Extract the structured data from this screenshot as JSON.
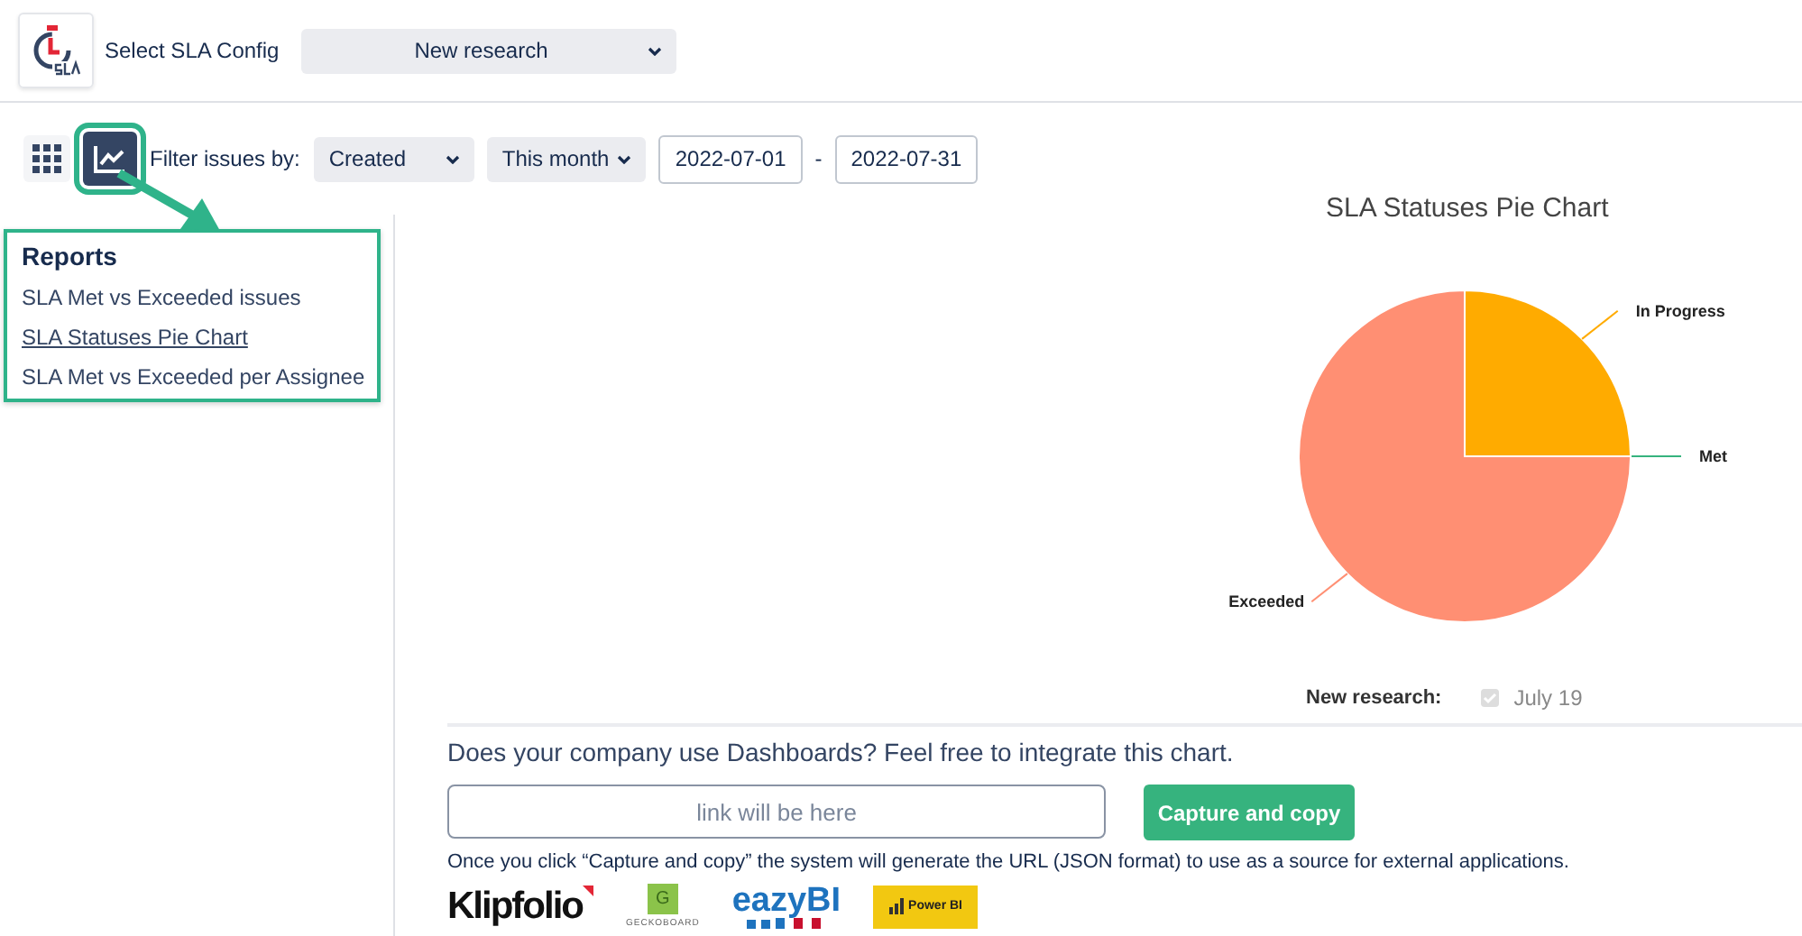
{
  "header": {
    "label": "Select SLA Config",
    "config": "New research"
  },
  "filter": {
    "label": "Filter issues by:",
    "field": "Created",
    "period": "This month",
    "from": "2022-07-01",
    "separator": "-",
    "to": "2022-07-31"
  },
  "views": [
    {
      "kind": "grid",
      "selected": false
    },
    {
      "kind": "chart",
      "selected": true
    }
  ],
  "reports": {
    "title": "Reports",
    "items": [
      {
        "label": "SLA Met vs Exceeded issues",
        "selected": false
      },
      {
        "label": "SLA Statuses Pie Chart",
        "selected": true
      },
      {
        "label": "SLA Met vs Exceeded per Assignee",
        "selected": false
      }
    ]
  },
  "chart_data": {
    "type": "pie",
    "title": "SLA Statuses Pie Chart",
    "categories": [
      "In Progress",
      "Met",
      "Exceeded"
    ],
    "series": [
      {
        "name": "New research:",
        "values": [
          25,
          0,
          75
        ]
      }
    ],
    "colors": [
      "#ffab00",
      "#36b37e",
      "#ff8f73"
    ]
  },
  "legend": {
    "item": "July 19",
    "checked": true
  },
  "integrate": {
    "question": "Does your company use Dashboards? Feel free to integrate this chart.",
    "placeholder": "link will be here",
    "button": "Capture and copy",
    "note": "Once you click “Capture and copy” the system will generate the URL (JSON format) to use as a source for external applications."
  },
  "logos": [
    {
      "kind": "klipfolio",
      "text": "Klipfolio"
    },
    {
      "kind": "geckoboard",
      "mark": "G",
      "text": "GECKOBOARD"
    },
    {
      "kind": "eazybi",
      "text": "eazyBI"
    },
    {
      "kind": "powerbi",
      "text": "Power BI"
    }
  ]
}
